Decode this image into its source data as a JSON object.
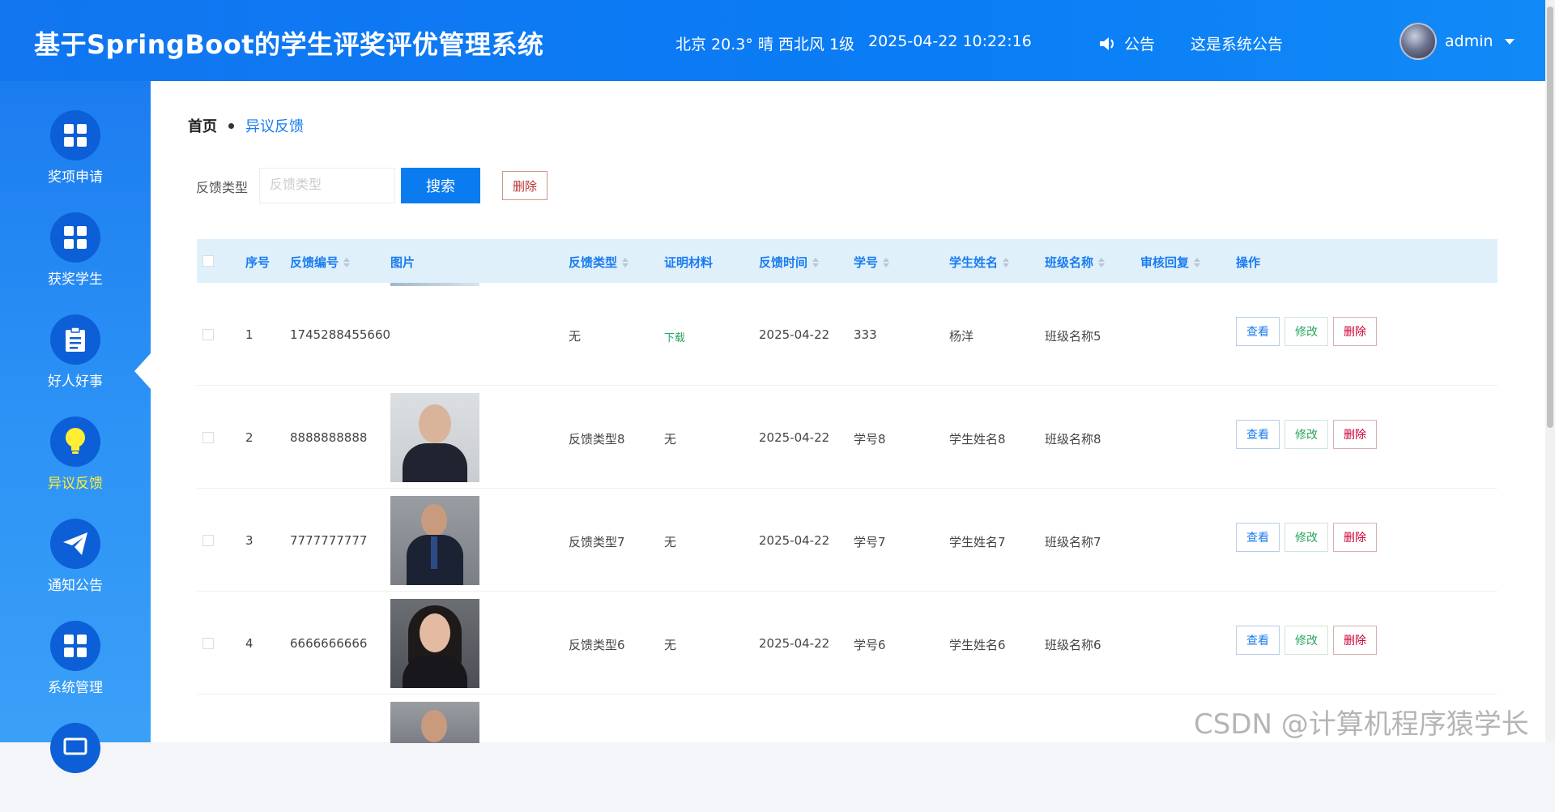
{
  "header": {
    "title": "基于SpringBoot的学生评奖评优管理系统",
    "weather": "北京  20.3°  晴  西北风  1级",
    "datetime": "2025-04-22 10:22:16",
    "notice_label": "公告",
    "notice_content": "这是系统公告",
    "username": "admin"
  },
  "sidebar": {
    "items": [
      {
        "label": "奖项申请",
        "icon": "grid-icon"
      },
      {
        "label": "获奖学生",
        "icon": "grid-icon"
      },
      {
        "label": "好人好事",
        "icon": "clipboard-icon"
      },
      {
        "label": "异议反馈",
        "icon": "lightbulb-icon",
        "active": true
      },
      {
        "label": "通知公告",
        "icon": "paper-plane-icon"
      },
      {
        "label": "系统管理",
        "icon": "grid-icon"
      }
    ]
  },
  "breadcrumb": {
    "home": "首页",
    "current": "异议反馈"
  },
  "search": {
    "label": "反馈类型",
    "placeholder": "反馈类型",
    "button": "搜索",
    "delete_button": "删除"
  },
  "table": {
    "headers": {
      "index": "序号",
      "code": "反馈编号",
      "image": "图片",
      "type": "反馈类型",
      "material": "证明材料",
      "time": "反馈时间",
      "student_no": "学号",
      "student_name": "学生姓名",
      "class_name": "班级名称",
      "review": "审核回复",
      "ops": "操作"
    },
    "rows": [
      {
        "index": "1",
        "code": "1745288455660",
        "type": "无",
        "material": "下载",
        "time": "2025-04-22",
        "student_no": "333",
        "student_name": "杨洋",
        "class_name": "班级名称5",
        "review": ""
      },
      {
        "index": "2",
        "code": "8888888888",
        "type": "反馈类型8",
        "material": "无",
        "time": "2025-04-22",
        "student_no": "学号8",
        "student_name": "学生姓名8",
        "class_name": "班级名称8",
        "review": ""
      },
      {
        "index": "3",
        "code": "7777777777",
        "type": "反馈类型7",
        "material": "无",
        "time": "2025-04-22",
        "student_no": "学号7",
        "student_name": "学生姓名7",
        "class_name": "班级名称7",
        "review": ""
      },
      {
        "index": "4",
        "code": "6666666666",
        "type": "反馈类型6",
        "material": "无",
        "time": "2025-04-22",
        "student_no": "学号6",
        "student_name": "学生姓名6",
        "class_name": "班级名称6",
        "review": ""
      }
    ],
    "actions": {
      "view": "查看",
      "edit": "修改",
      "delete": "删除"
    }
  },
  "watermark": "CSDN @计算机程序猿学长",
  "colors": {
    "primary": "#0a7cf0",
    "sidebar": "#2c92f5",
    "active_label": "#ffee33",
    "header_row": "#dff0fb"
  }
}
